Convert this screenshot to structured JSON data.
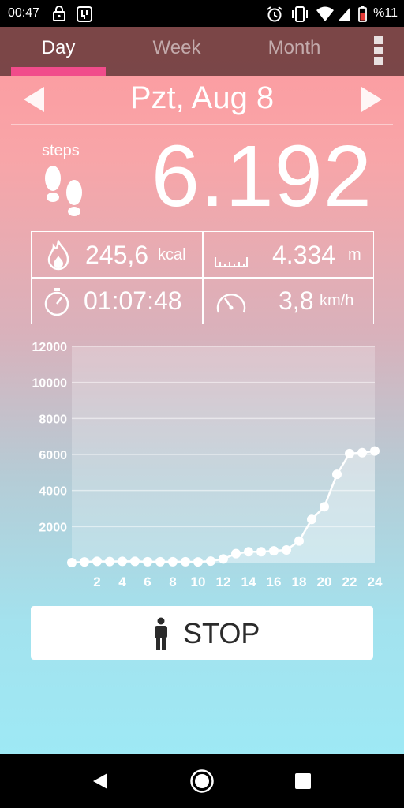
{
  "status_bar": {
    "time": "00:47",
    "battery_text": "%11",
    "icons": [
      "lock-icon",
      "sim-icon",
      "alarm-icon",
      "vibrate-icon",
      "wifi-icon",
      "signal-icon",
      "battery-icon"
    ]
  },
  "tabs": [
    {
      "label": "Day",
      "active": true
    },
    {
      "label": "Week",
      "active": false
    },
    {
      "label": "Month",
      "active": false
    }
  ],
  "date": {
    "label": "Pzt, Aug 8"
  },
  "steps": {
    "label": "steps",
    "value": "6.192"
  },
  "stats": {
    "calories": {
      "value": "245,6",
      "unit": "kcal"
    },
    "distance": {
      "value": "4.334",
      "unit": "m"
    },
    "duration": {
      "value": "01:07:48"
    },
    "speed": {
      "value": "3,8",
      "unit": "km/h"
    }
  },
  "chart_data": {
    "type": "line",
    "x": [
      0,
      1,
      2,
      3,
      4,
      5,
      6,
      7,
      8,
      9,
      10,
      11,
      12,
      13,
      14,
      15,
      16,
      17,
      18,
      19,
      20,
      21,
      22,
      23,
      24
    ],
    "values": [
      0,
      40,
      70,
      60,
      70,
      70,
      50,
      50,
      50,
      50,
      40,
      80,
      200,
      500,
      600,
      600,
      650,
      700,
      1200,
      2400,
      3100,
      4900,
      6050,
      6100,
      6192
    ],
    "xticks": [
      "2",
      "4",
      "6",
      "8",
      "10",
      "12",
      "14",
      "16",
      "18",
      "20",
      "22",
      "24"
    ],
    "yticks": [
      "2000",
      "4000",
      "6000",
      "8000",
      "10000",
      "12000"
    ],
    "ylim": [
      0,
      12000
    ],
    "xlim": [
      0,
      24
    ],
    "grid": true
  },
  "stop_button": {
    "label": "STOP"
  },
  "nav": {
    "back": "back-icon",
    "home": "home-icon",
    "recents": "recents-icon"
  },
  "colors": {
    "accent": "#f14c8b",
    "tab_bar": "#5a2e2e"
  }
}
